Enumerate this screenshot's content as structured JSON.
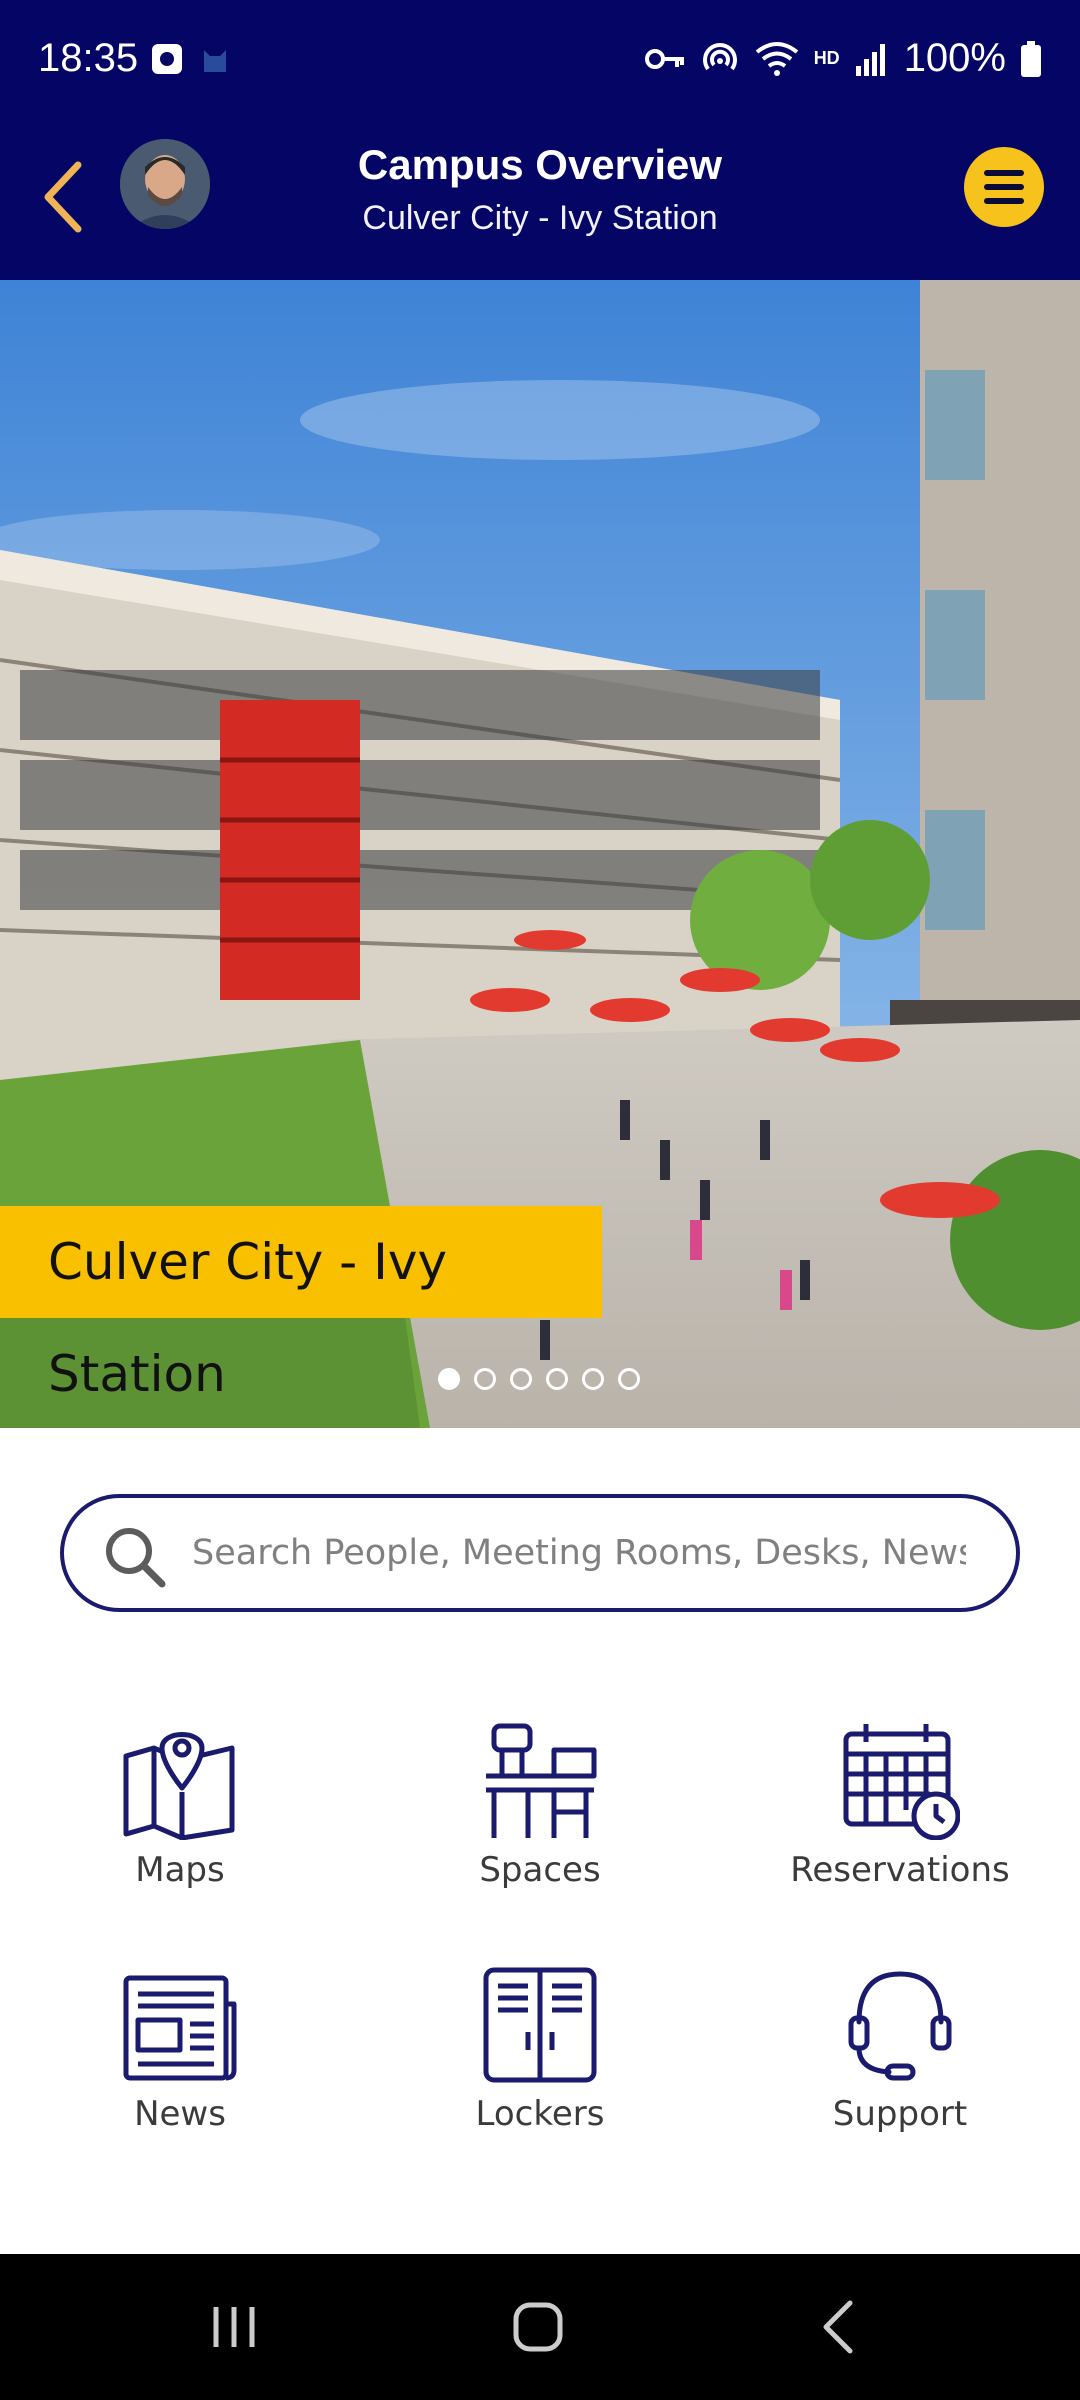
{
  "status": {
    "time": "18:35",
    "battery": "100%",
    "icons": [
      "key-icon",
      "hotspot-icon",
      "wifi-icon",
      "hd-icon",
      "signal-icon",
      "battery-icon"
    ],
    "hd_label": "HD"
  },
  "header": {
    "title": "Campus Overview",
    "subtitle": "Culver City - Ivy Station",
    "accent": "#f7c21b",
    "bg": "#050565"
  },
  "hero": {
    "caption": "Culver City - Ivy Station",
    "carousel_count": 6,
    "active_index": 0
  },
  "search": {
    "placeholder": "Search People, Meeting Rooms, Desks, News ..."
  },
  "tiles": [
    {
      "label": "Maps",
      "icon": "map-icon"
    },
    {
      "label": "Spaces",
      "icon": "desk-icon"
    },
    {
      "label": "Reservations",
      "icon": "calendar-icon"
    },
    {
      "label": "News",
      "icon": "newspaper-icon"
    },
    {
      "label": "Lockers",
      "icon": "locker-icon"
    },
    {
      "label": "Support",
      "icon": "headset-icon"
    }
  ],
  "navbar": {
    "buttons": [
      "recent-apps",
      "home",
      "back"
    ]
  }
}
